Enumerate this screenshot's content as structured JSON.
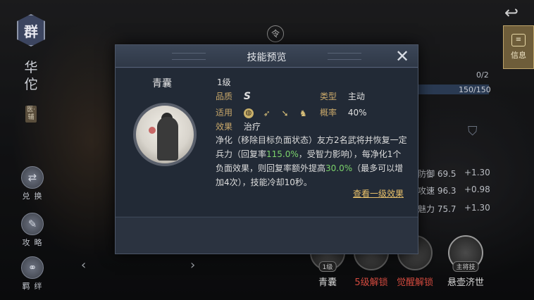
{
  "hero": {
    "faction": "群",
    "name": "华佗",
    "badge": "医·辅"
  },
  "side_buttons": [
    {
      "label": "兑换",
      "icon": "exchange-icon"
    },
    {
      "label": "攻略",
      "icon": "guide-icon"
    },
    {
      "label": "羁绊",
      "icon": "bond-icon"
    }
  ],
  "top": {
    "back_icon": "back-arrow-icon",
    "ling": "令",
    "info_label": "信息"
  },
  "right_panel": {
    "count": "0/2",
    "bar_value": "150/150",
    "stats": [
      {
        "label": "防御",
        "value": "69.5",
        "bonus": "+1.30"
      },
      {
        "label": "攻速",
        "value": "96.3",
        "bonus": "+0.98"
      },
      {
        "label": "魅力",
        "value": "75.7",
        "bonus": "+1.30"
      }
    ]
  },
  "skills_row": [
    {
      "name": "青囊",
      "tag": "1级",
      "color": "#d8d8d8"
    },
    {
      "name": "5级解锁",
      "tag": "",
      "color": "#d24a3e"
    },
    {
      "name": "觉醒解锁",
      "tag": "",
      "color": "#d24a3e"
    },
    {
      "name": "悬壶济世",
      "tag": "主将技",
      "color": "#d8d8d8"
    }
  ],
  "dialog": {
    "title": "技能预览",
    "skill_name": "青囊",
    "level": "1级",
    "quality_label": "品质",
    "quality_value": "S",
    "type_label": "类型",
    "type_value": "主动",
    "apply_label": "适用",
    "apply_icons": [
      "shield-icon",
      "bow-icon",
      "spear-icon",
      "horse-icon"
    ],
    "rate_label": "概率",
    "rate_value": "40%",
    "effect_label": "效果",
    "effect_value": "治疗",
    "desc": {
      "p1": "净化（移除目标负面状态）友方2名武将并恢复一定兵力（回复率",
      "h1": "115.0%",
      "p2": "，受智力影响），每净化1个负面效果，则回复率额外提高",
      "h2": "30.0%",
      "p3": "（最多可以增加4次），技能冷却10秒。"
    },
    "view_link": "查看一级效果",
    "close_icon": "close-icon"
  }
}
